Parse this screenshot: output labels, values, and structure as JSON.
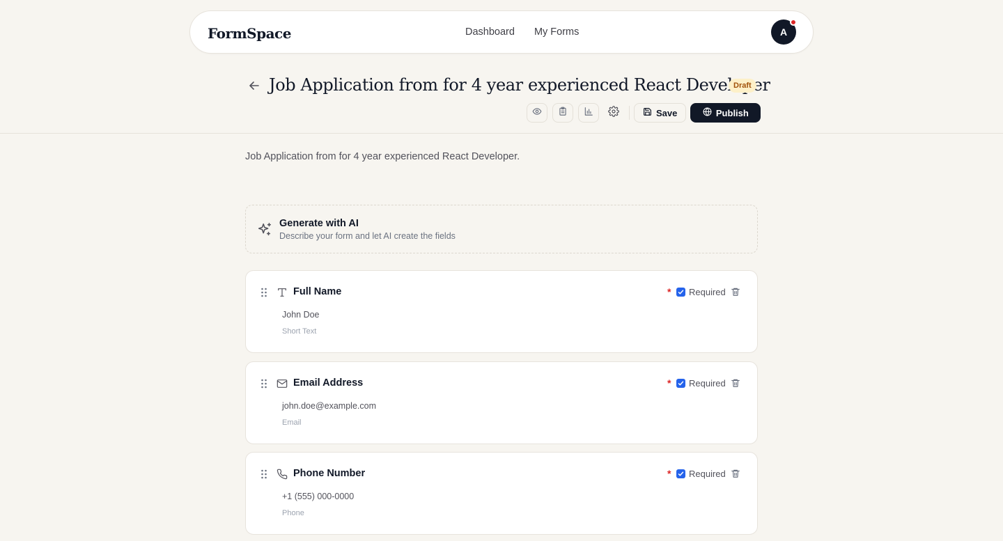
{
  "nav": {
    "brand": "FormSpace",
    "links": [
      "Dashboard",
      "My Forms"
    ],
    "avatar_initial": "A"
  },
  "header": {
    "title": "Job Application from for 4 year experienced React Developer",
    "status": "Draft",
    "toolbar": {
      "icons": [
        "eye-icon",
        "clipboard-icon",
        "bar-chart-icon",
        "gear-icon"
      ],
      "save_label": "Save",
      "publish_label": "Publish"
    }
  },
  "form": {
    "description": "Job Application from for 4 year experienced React Developer."
  },
  "ai": {
    "title": "Generate with AI",
    "subtitle": "Describe your form and let AI create the fields"
  },
  "fields": [
    {
      "icon": "text-icon",
      "label": "Full Name",
      "required_mark": "*",
      "required": true,
      "required_label": "Required",
      "placeholder": "John Doe",
      "type": "Short Text"
    },
    {
      "icon": "mail-icon",
      "label": "Email Address",
      "required_mark": "*",
      "required": true,
      "required_label": "Required",
      "placeholder": "john.doe@example.com",
      "type": "Email"
    },
    {
      "icon": "phone-icon",
      "label": "Phone Number",
      "required_mark": "*",
      "required": true,
      "required_label": "Required",
      "placeholder": "+1 (555) 000-0000",
      "type": "Phone"
    }
  ],
  "colors": {
    "background": "#f7f5f0",
    "primary": "#111827",
    "badge_bg": "#fdf0c8",
    "badge_text": "#a1520b",
    "required": "#dc2626",
    "checkbox": "#2563eb"
  }
}
